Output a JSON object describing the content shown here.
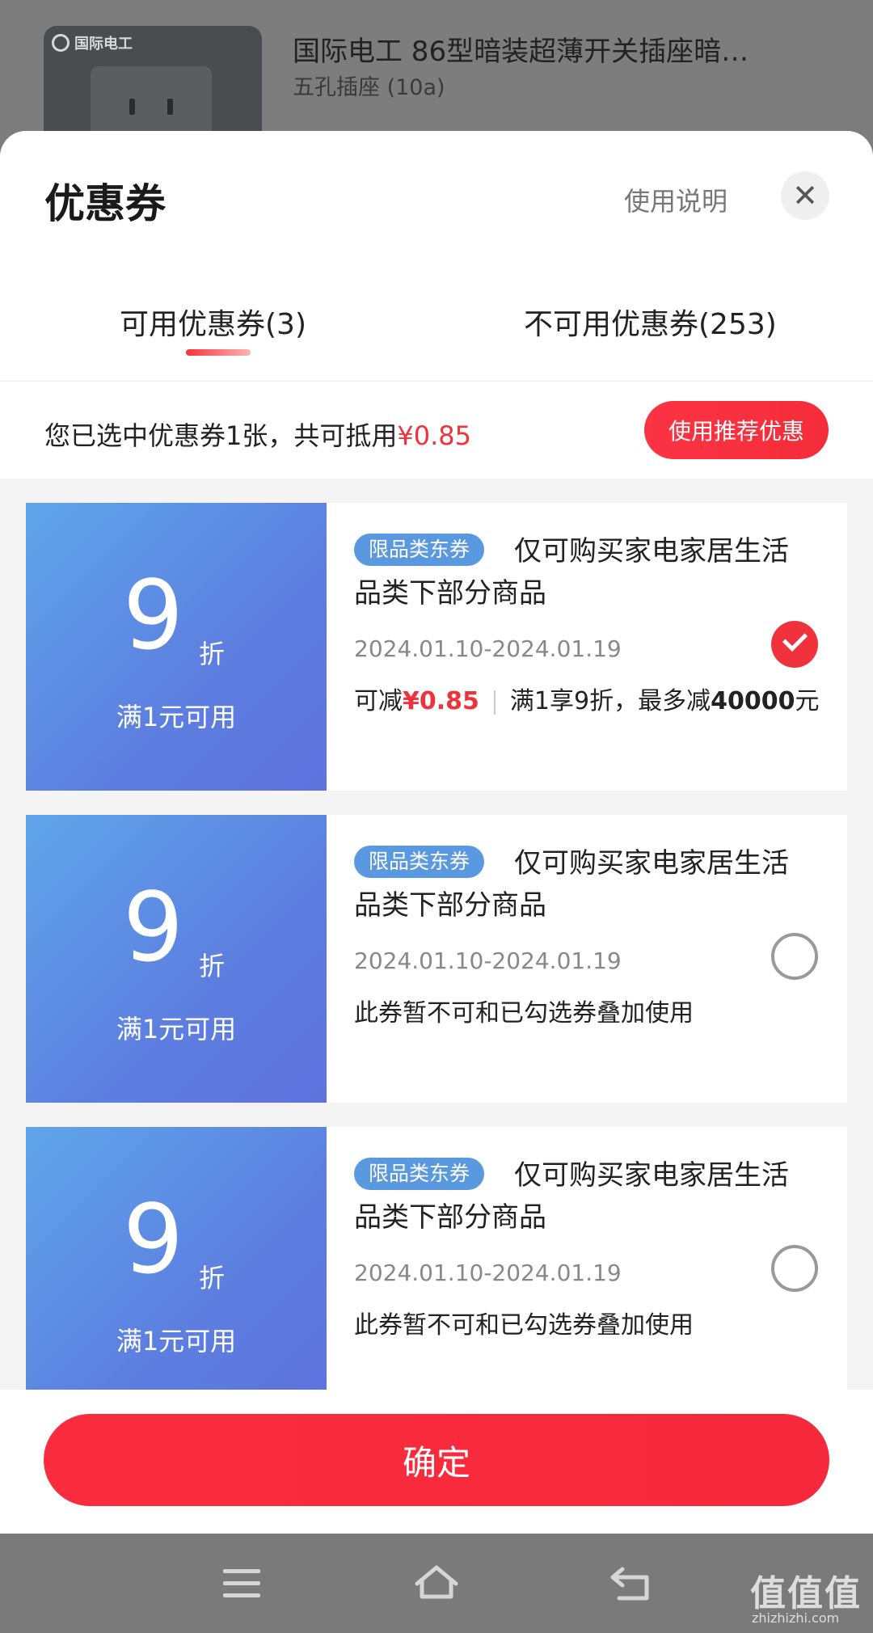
{
  "product": {
    "brand_logo_text": "国际电工",
    "title": "国际电工 86型暗装超薄开关插座暗…",
    "spec": "五孔插座 (10a)"
  },
  "sheet": {
    "title": "优惠券",
    "help_label": "使用说明",
    "close_glyph": "✕",
    "tabs": [
      {
        "label": "可用优惠券(3)",
        "active": true
      },
      {
        "label": "不可用优惠券(253)",
        "active": false
      }
    ],
    "summary": {
      "text": "您已选中优惠券1张，共可抵用",
      "amount": "¥0.85",
      "recommend_label": "使用推荐优惠"
    },
    "coupons": [
      {
        "discount": "9",
        "unit": "折",
        "threshold": "满1元可用",
        "tag": "限品类东券",
        "description": "仅可购买家电家居生活品类下部分商品",
        "date_range": "2024.01.10-2024.01.19",
        "note_prefix": "可减",
        "note_amount": "¥0.85",
        "note_rule": "满1享9折，最多减",
        "note_max": "40000",
        "note_unit": "元",
        "selected": true
      },
      {
        "discount": "9",
        "unit": "折",
        "threshold": "满1元可用",
        "tag": "限品类东券",
        "description": "仅可购买家电家居生活品类下部分商品",
        "date_range": "2024.01.10-2024.01.19",
        "note": "此券暂不可和已勾选券叠加使用",
        "selected": false
      },
      {
        "discount": "9",
        "unit": "折",
        "threshold": "满1元可用",
        "tag": "限品类东券",
        "description": "仅可购买家电家居生活品类下部分商品",
        "date_range": "2024.01.10-2024.01.19",
        "note": "此券暂不可和已勾选券叠加使用",
        "selected": false
      }
    ],
    "confirm_label": "确定"
  },
  "watermark": {
    "text": "值值值",
    "url": "zhizhizhi.com"
  },
  "colors": {
    "accent_red": "#f0323c",
    "coupon_blue": "#5d7fe0",
    "tag_blue": "#5a98e0"
  }
}
